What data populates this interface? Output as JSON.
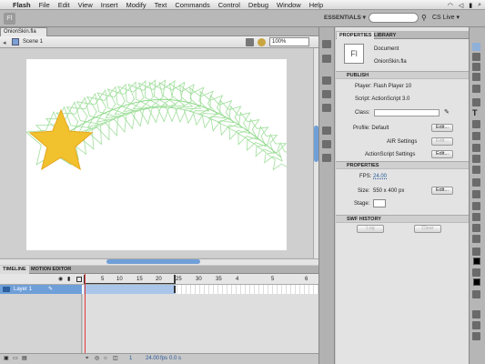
{
  "menubar": {
    "app": "Flash",
    "items": [
      "File",
      "Edit",
      "View",
      "Insert",
      "Modify",
      "Text",
      "Commands",
      "Control",
      "Debug",
      "Window",
      "Help"
    ],
    "status": {
      "battery": "▮",
      "time": "",
      "search": "⌕"
    }
  },
  "appbar": {
    "logo": "Fl",
    "workspace": "ESSENTIALS ▾",
    "search_placeholder": "",
    "cs_live": "CS Live ▾"
  },
  "document": {
    "tab_label": "OnionSkin.fla",
    "scene_label": "Scene 1",
    "zoom": "100%"
  },
  "timeline": {
    "tabs": [
      "TIMELINE",
      "MOTION EDITOR"
    ],
    "ruler_numbers": [
      "5",
      "10",
      "15",
      "20",
      "25",
      "30",
      "35",
      "4",
      "5",
      "6"
    ],
    "layer_name": "Layer 1",
    "footer": {
      "frame": "1",
      "fps": "24.00",
      "fps_unit": "fps",
      "time": "0.0 s"
    }
  },
  "panel": {
    "tabs": [
      "PROPERTIES",
      "LIBRARY"
    ],
    "doc_icon": "Fl",
    "doc_type": "Document",
    "doc_name": "OnionSkin.fla",
    "publish": {
      "header": "PUBLISH",
      "player": "Player: Flash Player 10",
      "script": "Script: ActionScript 3.0",
      "class_label": "Class:",
      "profile": "Profile: Default",
      "edit": "Edit...",
      "air": "AIR Settings",
      "as_settings": "ActionScript Settings"
    },
    "properties": {
      "header": "PROPERTIES",
      "fps_label": "FPS:",
      "fps_value": "24.00",
      "size_label": "Size:",
      "size_value": "550 x 400 px",
      "stage_label": "Stage:",
      "stage_color": "#ffffff"
    },
    "swf_history": {
      "header": "SWF HISTORY",
      "log": "Log",
      "clear": "Clear"
    }
  },
  "colors": {
    "star": "#f2c12e",
    "onion": "#8fd98a",
    "accent": "#6f9fd8"
  }
}
